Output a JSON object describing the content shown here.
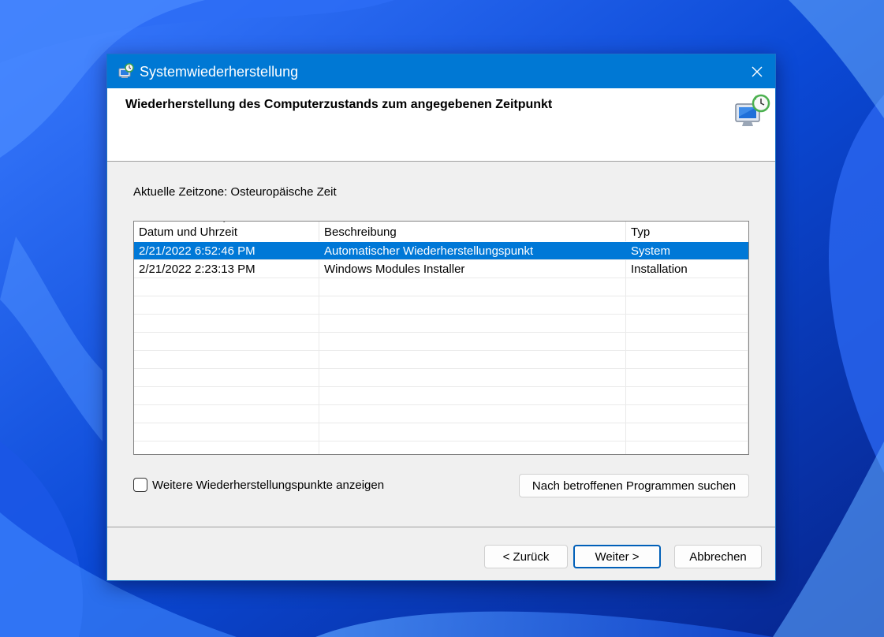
{
  "window": {
    "title": "Systemwiederherstellung",
    "close_label": "✕"
  },
  "header": {
    "title": "Wiederherstellung des Computerzustands zum angegebenen Zeitpunkt"
  },
  "timezone_text": "Aktuelle Zeitzone: Osteuropäische Zeit",
  "table": {
    "columns": [
      "Datum und Uhrzeit",
      "Beschreibung",
      "Typ"
    ],
    "sorted_column": "Datum und Uhrzeit",
    "sort_direction": "descending",
    "rows": [
      {
        "date": "2/21/2022 6:52:46 PM",
        "description": "Automatischer Wiederherstellungspunkt",
        "type": "System",
        "selected": true
      },
      {
        "date": "2/21/2022 2:23:13 PM",
        "description": "Windows Modules Installer",
        "type": "Installation",
        "selected": false
      }
    ]
  },
  "more_points": {
    "label": "Weitere Wiederherstellungspunkte anzeigen",
    "checked": false
  },
  "buttons": {
    "scan": "Nach betroffenen Programmen suchen",
    "back": "< Zurück",
    "next": "Weiter >",
    "cancel": "Abbrechen"
  },
  "colors": {
    "titlebar": "#0078d4",
    "selection": "#0078d7",
    "wallpaper_base": "#0a3fc2"
  }
}
